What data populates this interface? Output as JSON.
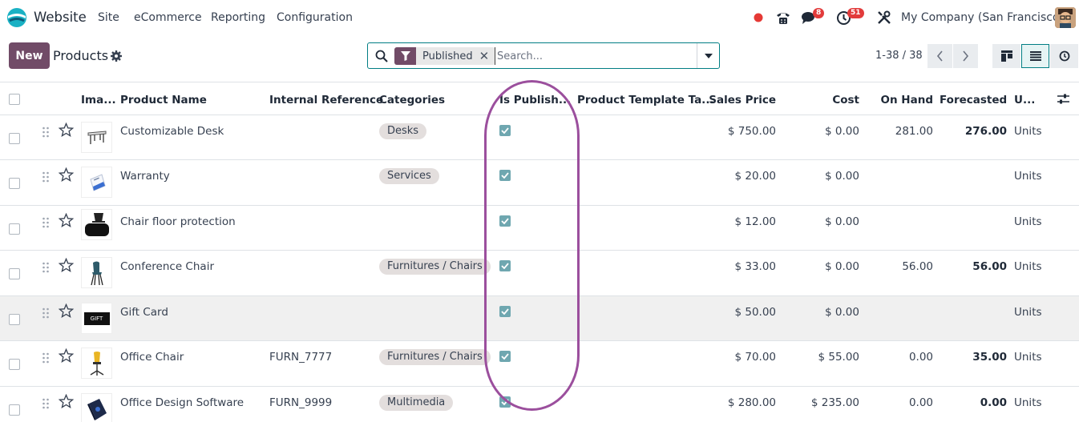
{
  "navbar": {
    "app_name": "Website",
    "menu": [
      "Site",
      "eCommerce",
      "Reporting",
      "Configuration"
    ],
    "chat_badge": "8",
    "activity_badge": "51",
    "company": "My Company (San Francisco)"
  },
  "control": {
    "new_label": "New",
    "title": "Products",
    "facet_label": "Published",
    "search_placeholder": "Search...",
    "pager": "1-38 / 38"
  },
  "columns": {
    "image": "Ima...",
    "name": "Product Name",
    "ref": "Internal Reference",
    "categories": "Categories",
    "published": "Is Publish...",
    "template_tags": "Product Template Ta...",
    "price": "Sales Price",
    "cost": "Cost",
    "on_hand": "On Hand",
    "forecasted": "Forecasted",
    "uom": "U..."
  },
  "rows": [
    {
      "name": "Customizable Desk",
      "ref": "",
      "category": "Desks",
      "published": true,
      "price": "$ 750.00",
      "cost": "$ 0.00",
      "on_hand": "281.00",
      "forecasted": "276.00",
      "uom": "Units"
    },
    {
      "name": "Warranty",
      "ref": "",
      "category": "Services",
      "published": true,
      "price": "$ 20.00",
      "cost": "$ 0.00",
      "on_hand": "",
      "forecasted": "",
      "uom": "Units"
    },
    {
      "name": "Chair floor protection",
      "ref": "",
      "category": "",
      "published": true,
      "price": "$ 12.00",
      "cost": "$ 0.00",
      "on_hand": "",
      "forecasted": "",
      "uom": "Units"
    },
    {
      "name": "Conference Chair",
      "ref": "",
      "category": "Furnitures / Chairs",
      "published": true,
      "price": "$ 33.00",
      "cost": "$ 0.00",
      "on_hand": "56.00",
      "forecasted": "56.00",
      "uom": "Units"
    },
    {
      "name": "Gift Card",
      "ref": "",
      "category": "",
      "published": true,
      "price": "$ 50.00",
      "cost": "$ 0.00",
      "on_hand": "",
      "forecasted": "",
      "uom": "Units",
      "thumb_text": "GIFT"
    },
    {
      "name": "Office Chair",
      "ref": "FURN_7777",
      "category": "Furnitures / Chairs",
      "published": true,
      "price": "$ 70.00",
      "cost": "$ 55.00",
      "on_hand": "0.00",
      "forecasted": "35.00",
      "uom": "Units"
    },
    {
      "name": "Office Design Software",
      "ref": "FURN_9999",
      "category": "Multimedia",
      "published": true,
      "price": "$ 280.00",
      "cost": "$ 235.00",
      "on_hand": "0.00",
      "forecasted": "0.00",
      "uom": "Units"
    }
  ],
  "colors": {
    "accent": "#714b67",
    "teal": "#017e84",
    "highlight": "#9b4f9d"
  }
}
